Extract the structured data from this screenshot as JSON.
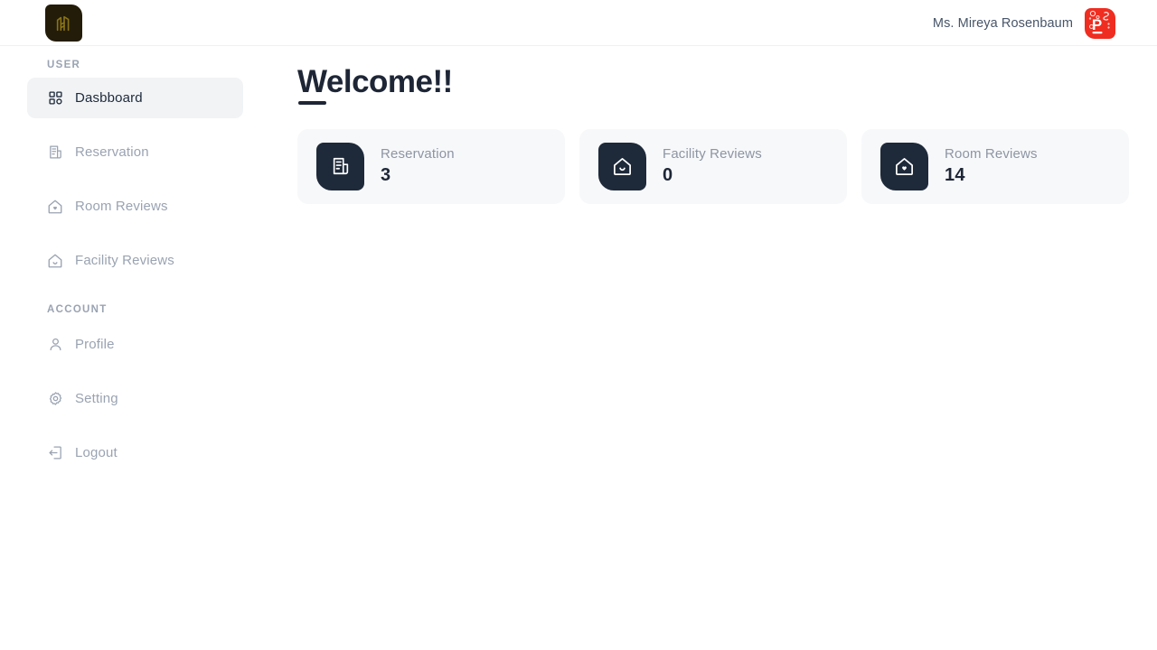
{
  "header": {
    "logo_icon": "hotel-brand-logo-icon",
    "user_name": "Ms. Mireya Rosenbaum",
    "avatar_letter": "P",
    "avatar_icon": "user-avatar-p-icon",
    "avatar_color": "#ef2d20",
    "logo_color": "#231c09"
  },
  "sidebar": {
    "sections": [
      {
        "title": "USER",
        "items": [
          {
            "label": "Dasbboard",
            "icon": "grid-dashboard-icon",
            "active": true
          },
          {
            "label": "Reservation",
            "icon": "receipt-document-icon",
            "active": false
          },
          {
            "label": "Room Reviews",
            "icon": "house-heart-icon",
            "active": false
          },
          {
            "label": "Facility Reviews",
            "icon": "house-icon",
            "active": false
          }
        ]
      },
      {
        "title": "ACCOUNT",
        "items": [
          {
            "label": "Profile",
            "icon": "user-person-icon",
            "active": false
          },
          {
            "label": "Setting",
            "icon": "gear-settings-icon",
            "active": false
          },
          {
            "label": "Logout",
            "icon": "logout-arrow-icon",
            "active": false
          }
        ]
      }
    ]
  },
  "main": {
    "page_title": "Welcome!!",
    "cards": [
      {
        "label": "Reservation",
        "value": "3",
        "icon": "receipt-document-icon"
      },
      {
        "label": "Facility Reviews",
        "value": "0",
        "icon": "house-smile-icon"
      },
      {
        "label": "Room Reviews",
        "value": "14",
        "icon": "house-heart-icon"
      }
    ]
  },
  "theme": {
    "accent_dark": "#1e2a3a",
    "card_bg": "#f7f8fa",
    "muted_text": "#9aa3b2"
  }
}
